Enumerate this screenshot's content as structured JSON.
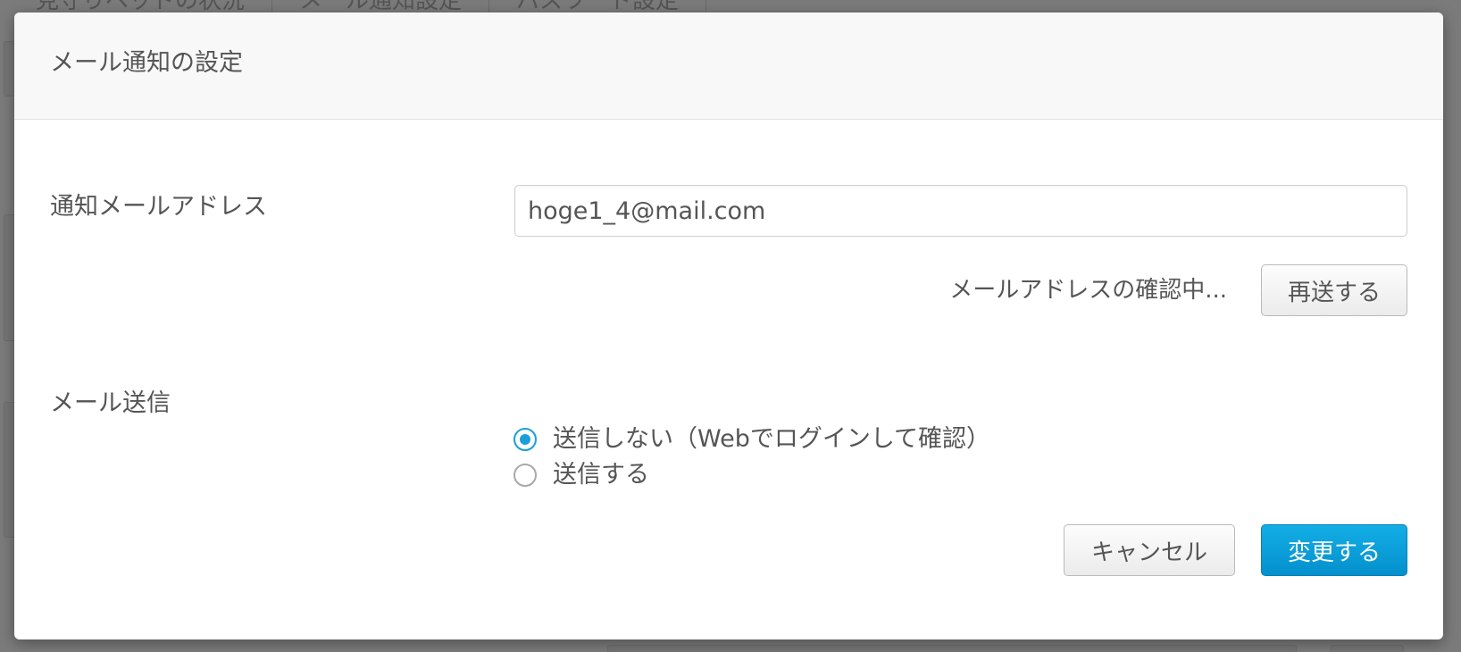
{
  "background": {
    "tabs": [
      "見守りベッドの状況",
      "メール通知設定",
      "パスワード設定"
    ]
  },
  "modal": {
    "title": "メール通知の設定",
    "email_section": {
      "label": "通知メールアドレス",
      "value": "hoge1_4@mail.com",
      "verify_status": "メールアドレスの確認中...",
      "resend_label": "再送する"
    },
    "send_section": {
      "label": "メール送信",
      "options": [
        {
          "label": "送信しない（Webでログインして確認）",
          "selected": true
        },
        {
          "label": "送信する",
          "selected": false
        }
      ]
    },
    "footer": {
      "cancel_label": "キャンセル",
      "submit_label": "変更する"
    }
  },
  "colors": {
    "primary": "#0a9fd8",
    "text": "#555555",
    "overlay": "#7b7b7b"
  }
}
